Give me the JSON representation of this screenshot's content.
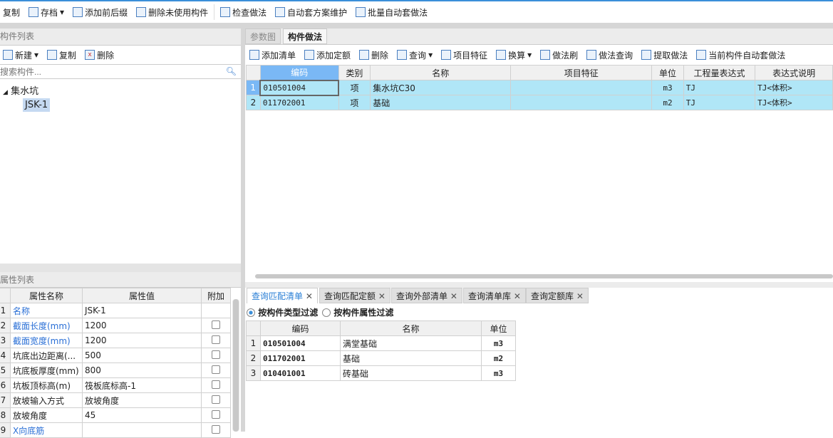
{
  "toolbar": {
    "items": [
      "复制",
      "存档",
      "添加前后缀",
      "删除未使用构件",
      "检查做法",
      "自动套方案维护",
      "批量自动套做法"
    ]
  },
  "left": {
    "title": "构件列表",
    "actions": [
      "新建",
      "复制",
      "删除"
    ],
    "search_placeholder": "搜索构件...",
    "tree": {
      "parent": "集水坑",
      "child": "JSK-1"
    }
  },
  "props": {
    "title": "属性列表",
    "headers": [
      "属性名称",
      "属性值",
      "附加"
    ],
    "rows": [
      {
        "n": "1",
        "name": "名称",
        "value": "JSK-1",
        "blue": true,
        "cb": false
      },
      {
        "n": "2",
        "name": "截面长度(mm)",
        "value": "1200",
        "blue": true,
        "cb": true
      },
      {
        "n": "3",
        "name": "截面宽度(mm)",
        "value": "1200",
        "blue": true,
        "cb": true
      },
      {
        "n": "4",
        "name": "坑底出边距离(...",
        "value": "500",
        "blue": false,
        "cb": true
      },
      {
        "n": "5",
        "name": "坑底板厚度(mm)",
        "value": "800",
        "blue": false,
        "cb": true
      },
      {
        "n": "6",
        "name": "坑板顶标高(m)",
        "value": "筏板底标高-1",
        "blue": false,
        "cb": true
      },
      {
        "n": "7",
        "name": "放坡输入方式",
        "value": "放坡角度",
        "blue": false,
        "cb": true
      },
      {
        "n": "8",
        "name": "放坡角度",
        "value": "45",
        "blue": false,
        "cb": true
      },
      {
        "n": "9",
        "name": "X向底筋",
        "value": "",
        "blue": true,
        "cb": true
      }
    ]
  },
  "right": {
    "tabs": [
      "参数图",
      "构件做法"
    ],
    "actions": [
      "添加清单",
      "添加定额",
      "删除",
      "查询",
      "项目特征",
      "换算",
      "做法刷",
      "做法查询",
      "提取做法",
      "当前构件自动套做法"
    ],
    "grid": {
      "headers": [
        "编码",
        "类别",
        "名称",
        "项目特征",
        "单位",
        "工程量表达式",
        "表达式说明"
      ],
      "rows": [
        {
          "n": "1",
          "code": "010501004",
          "type": "项",
          "name": "集水坑C30",
          "feature": "",
          "unit": "m3",
          "expr": "TJ",
          "desc": "TJ<体积>"
        },
        {
          "n": "2",
          "code": "011702001",
          "type": "项",
          "name": "基础",
          "feature": "",
          "unit": "m2",
          "expr": "TJ",
          "desc": "TJ<体积>"
        }
      ]
    }
  },
  "bottom": {
    "tabs": [
      "查询匹配清单",
      "查询匹配定额",
      "查询外部清单",
      "查询清单库",
      "查询定额库"
    ],
    "filters": [
      "按构件类型过滤",
      "按构件属性过滤"
    ],
    "headers": [
      "编码",
      "名称",
      "单位"
    ],
    "rows": [
      {
        "n": "1",
        "code": "010501004",
        "name": "满堂基础",
        "unit": "m3"
      },
      {
        "n": "2",
        "code": "011702001",
        "name": "基础",
        "unit": "m2"
      },
      {
        "n": "3",
        "code": "010401001",
        "name": "砖基础",
        "unit": "m3"
      }
    ]
  }
}
